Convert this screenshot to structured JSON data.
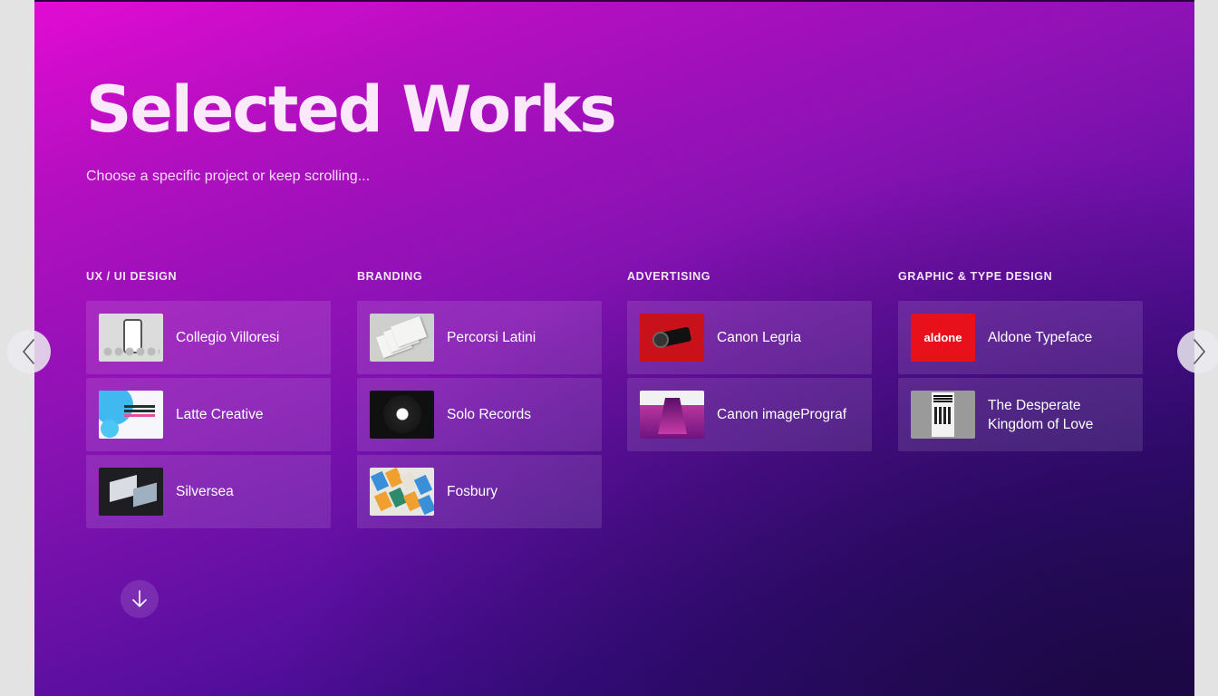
{
  "hero": {
    "title": "Selected Works",
    "subtitle": "Choose a specific project or keep scrolling..."
  },
  "categories": [
    {
      "heading": "UX / UI DESIGN",
      "projects": [
        {
          "label": "Collegio Villoresi",
          "thumb": "collegio-thumbnail"
        },
        {
          "label": "Latte Creative",
          "thumb": "latte-thumbnail"
        },
        {
          "label": "Silversea",
          "thumb": "silversea-thumbnail"
        }
      ]
    },
    {
      "heading": "BRANDING",
      "projects": [
        {
          "label": "Percorsi Latini",
          "thumb": "percorsi-thumbnail"
        },
        {
          "label": "Solo Records",
          "thumb": "solo-thumbnail"
        },
        {
          "label": "Fosbury",
          "thumb": "fosbury-thumbnail"
        }
      ]
    },
    {
      "heading": "ADVERTISING",
      "projects": [
        {
          "label": "Canon Legria",
          "thumb": "legria-thumbnail"
        },
        {
          "label": "Canon imagePrograf",
          "thumb": "prograf-thumbnail"
        }
      ]
    },
    {
      "heading": "GRAPHIC & TYPE DESIGN",
      "projects": [
        {
          "label": "Aldone Typeface",
          "thumb": "aldone-thumbnail",
          "logo_text": "aldone"
        },
        {
          "label": "The Desperate Kingdom of Love",
          "thumb": "desperate-thumbnail"
        }
      ]
    }
  ],
  "nav": {
    "prev_icon": "chevron-left-icon",
    "next_icon": "chevron-right-icon",
    "scroll_icon": "arrow-down-icon"
  },
  "colors": {
    "gradient_start": "#e20bd3",
    "gradient_end": "#2a0a6a",
    "text": "#ffffff"
  }
}
